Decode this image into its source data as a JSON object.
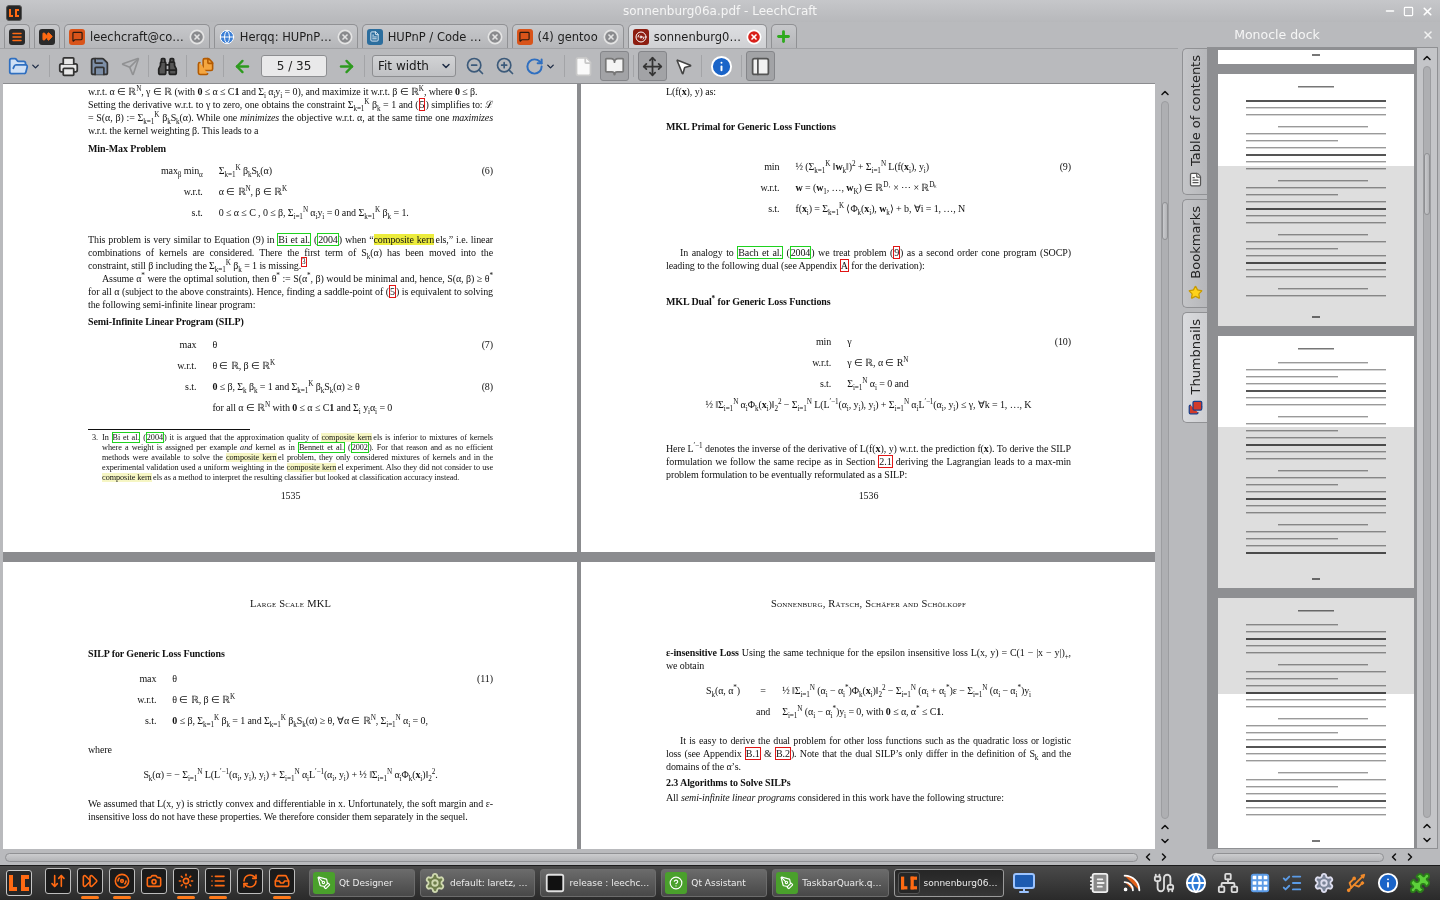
{
  "window": {
    "title": "sonnenburg06a.pdf - LeechCraft"
  },
  "tabs": [
    {
      "kind": "menu",
      "selected": false
    },
    {
      "kind": "media",
      "selected": false
    },
    {
      "kind": "chat",
      "label": "leechcraft@co…",
      "selected": false
    },
    {
      "kind": "web",
      "label": "Herqq: HUPnP…",
      "selected": false
    },
    {
      "kind": "project",
      "label": "HUPnP / Code …",
      "selected": false
    },
    {
      "kind": "chat",
      "label": "(4) gentoo",
      "selected": false
    },
    {
      "kind": "document",
      "label": "sonnenburg0…",
      "selected": true
    }
  ],
  "toolbar": {
    "items": [
      {
        "kind": "open",
        "disabled": false
      },
      {
        "kind": "separator"
      },
      {
        "kind": "print",
        "disabled": false
      },
      {
        "kind": "save",
        "disabled": false
      },
      {
        "kind": "export",
        "disabled": true
      },
      {
        "kind": "separator"
      },
      {
        "kind": "find",
        "disabled": false
      },
      {
        "kind": "separator"
      },
      {
        "kind": "copy",
        "disabled": false
      },
      {
        "kind": "separator"
      },
      {
        "kind": "prev_page",
        "disabled": false
      },
      {
        "kind": "page_field",
        "value": "5 / 35"
      },
      {
        "kind": "next_page",
        "disabled": false
      },
      {
        "kind": "separator"
      },
      {
        "kind": "zoom_mode",
        "value": "Fit width"
      },
      {
        "kind": "zoom_out",
        "disabled": false
      },
      {
        "kind": "zoom_in",
        "disabled": false
      },
      {
        "kind": "rotate",
        "disabled": false
      },
      {
        "kind": "separator"
      },
      {
        "kind": "one_page",
        "selected": false,
        "disabled": false
      },
      {
        "kind": "two_pages",
        "selected": true,
        "disabled": false
      },
      {
        "kind": "separator"
      },
      {
        "kind": "pan",
        "selected": true,
        "disabled": false
      },
      {
        "kind": "select",
        "selected": false,
        "disabled": false
      },
      {
        "kind": "separator"
      },
      {
        "kind": "info",
        "disabled": false
      },
      {
        "kind": "separator"
      },
      {
        "kind": "sidebar",
        "selected": true,
        "disabled": false
      }
    ]
  },
  "document": {
    "pages": [
      {
        "blocks": [
          {
            "kind": "paragraph",
            "indent": false,
            "parts": [
              {
                "kind": "text",
                "text": "w.r.t. α ∈ ℝ$^{N}$, γ ∈ ℝ (with **0** ≤ α ≤ C**1** and Σ$_{i}$ α$_{i}$y$_{i}$ = 0), and maximize it w.r.t. β ∈ ℝ$^{K}$, where **0** ≤ β."
              }
            ]
          },
          {
            "kind": "paragraph",
            "indent": false,
            "parts": [
              {
                "kind": "text",
                "text": "Setting the derivative w.r.t. to γ to zero, one obtains the constraint Σ$_{k=1}$$^{K}$ β$_{k}$ = 1 and ("
              },
              {
                "kind": "ref",
                "text": "5"
              },
              {
                "kind": "text",
                "text": ") simplifies to: ℒ = S(α, β) := Σ$_{k=1}$$^{K}$ β$_{k}$S$_{k}$(α). While one *minimizes* the objective w.r.t. α, at the same time one *maximizes* w.r.t. the kernel weighting β. This leads to a"
              }
            ]
          },
          {
            "kind": "heading",
            "text": "Min-Max Problem"
          },
          {
            "kind": "equation",
            "rows": [
              {
                "kind": "row",
                "label": "max$_{β}$ min$_{α}$",
                "expr": "Σ$_{k=1}$$^{K}$ β$_{k}$S$_{k}$(α)",
                "number": "(6)"
              },
              {
                "kind": "row",
                "label": "w.r.t.",
                "expr": "α ∈ ℝ$^{N}$, β ∈ ℝ$^{K}$"
              },
              {
                "kind": "row",
                "label": "s.t.",
                "expr": "0 ≤ α ≤ C , 0 ≤ β, Σ$_{i=1}$$^{N}$ α$_{i}$y$_{i}$ = 0 and Σ$_{k=1}$$^{K}$ β$_{k}$ = 1."
              }
            ]
          },
          {
            "kind": "paragraph",
            "indent": false,
            "parts": [
              {
                "kind": "text",
                "text": "This problem is very similar to Equation (9) in "
              },
              {
                "kind": "cite",
                "text": "Bi et al."
              },
              {
                "kind": "text",
                "text": " ("
              },
              {
                "kind": "cite",
                "text": "2004"
              },
              {
                "kind": "text",
                "text": ") when “"
              },
              {
                "kind": "mark",
                "text": "composite kern",
                "color": "#ecec3c"
              },
              {
                "kind": "text",
                "text": "els,” i.e. linear combinations of kernels are considered.  There the first term of S$_{k}$(α) has been moved into the constraint, still β including the Σ$_{k=1}$$^{K}$ β$_{k}$ = 1 is missing."
              },
              {
                "kind": "footnote_ref",
                "text": "3"
              }
            ]
          },
          {
            "kind": "paragraph",
            "indent": true,
            "parts": [
              {
                "kind": "text",
                "text": "Assume α$^{*}$ were the optimal solution, then θ$^{*}$ := S(α$^{*}$, β) would be minimal and, hence, S(α, β) ≥ θ$^{*}$ for all α (subject to the above constraints).  Hence, finding a saddle-point of ("
              },
              {
                "kind": "ref",
                "text": "5"
              },
              {
                "kind": "text",
                "text": ") is equivalent to solving the following semi-infinite linear program:"
              }
            ]
          },
          {
            "kind": "heading",
            "text": "Semi-Infinite Linear Program (SILP)"
          },
          {
            "kind": "equation",
            "rows": [
              {
                "kind": "row",
                "label": "max",
                "expr": "θ",
                "number": "(7)"
              },
              {
                "kind": "row",
                "label": "w.r.t.",
                "expr": "θ ∈ ℝ, β ∈ ℝ$^{K}$"
              },
              {
                "kind": "row",
                "label": "s.t.",
                "expr": "**0** ≤ β, Σ$_{k}$ β$_{k}$ = 1 and Σ$_{k=1}$$^{K}$ β$_{k}$S$_{k}$(α) ≥ θ",
                "number": "(8)"
              },
              {
                "kind": "row",
                "expr": "for all α ∈ ℝ$^{N}$ with **0** ≤ α ≤ C**1** and Σ$_{i}$ y$_{i}$α$_{i}$ = 0"
              }
            ]
          },
          {
            "kind": "footnote",
            "number": "3.",
            "parts": [
              {
                "kind": "text",
                "text": "In "
              },
              {
                "kind": "cite",
                "text": "Bi et al."
              },
              {
                "kind": "text",
                "text": " ("
              },
              {
                "kind": "cite",
                "text": "2004"
              },
              {
                "kind": "text",
                "text": ") it is argued that the approximation quality of "
              },
              {
                "kind": "mark",
                "text": "composite kern",
                "color": "#f6f6c4"
              },
              {
                "kind": "text",
                "text": "els is inferior to mixtures of kernels where a weight is assigned per example *and* kernel as in "
              },
              {
                "kind": "cite",
                "text": "Bennett et al."
              },
              {
                "kind": "text",
                "text": " ("
              },
              {
                "kind": "cite",
                "text": "2002"
              },
              {
                "kind": "text",
                "text": "). For that reason and as no efficient methods were available to solve the "
              },
              {
                "kind": "mark",
                "text": "composite kern",
                "color": "#f6f6c4"
              },
              {
                "kind": "text",
                "text": "el problem, they only considered mixtures of kernels and in the experimental validation used a uniform weighting in the "
              },
              {
                "kind": "mark",
                "text": "composite kern",
                "color": "#f6f6c4"
              },
              {
                "kind": "text",
                "text": "el experiment. Also they did not consider to use "
              },
              {
                "kind": "mark",
                "text": "composite kern",
                "color": "#f6f6c4"
              },
              {
                "kind": "text",
                "text": "els as a method to interpret the resulting classifier but looked at classification accuracy instead."
              }
            ]
          },
          {
            "kind": "page_number",
            "text": "1535"
          }
        ]
      },
      {
        "blocks": [
          {
            "kind": "paragraph",
            "indent": false,
            "parts": [
              {
                "kind": "text",
                "text": "L(f(**x**), y) as:"
              }
            ]
          },
          {
            "kind": "heading",
            "text": "MKL Primal for Generic Loss Functions"
          },
          {
            "kind": "equation",
            "rows": [
              {
                "kind": "row",
                "label": "min",
                "expr": "½ (Σ$_{k=1}$$^{K}$ ‖**w**$_{k}$‖)$^{2}$ + Σ$_{i=1}$$^{N}$ L(f(**x**$_{i}$), y$_{i}$)",
                "number": "(9)"
              },
              {
                "kind": "row",
                "label": "w.r.t.",
                "expr": "**w** = (**w**$_{1}$, …, **w**$_{K}$) ∈ ℝ$^{D₁}$ × ⋯ × ℝ$^{Dₖ}$"
              },
              {
                "kind": "row",
                "label": "s.t.",
                "expr": "f(**x**$_{i}$) = Σ$_{k=1}$$^{K}$ ⟨Φ$_{k}$(**x**$_{i}$), **w**$_{k}$⟩ + b,  ∀i = 1, …, N"
              }
            ]
          },
          {
            "kind": "paragraph",
            "indent": true,
            "parts": [
              {
                "kind": "text",
                "text": "In analogy to "
              },
              {
                "kind": "cite",
                "text": "Bach et al."
              },
              {
                "kind": "text",
                "text": " ("
              },
              {
                "kind": "cite",
                "text": "2004"
              },
              {
                "kind": "text",
                "text": ") we treat problem ("
              },
              {
                "kind": "ref",
                "text": "9"
              },
              {
                "kind": "text",
                "text": ") as a second order cone program (SOCP) leading to the following dual (see Appendix "
              },
              {
                "kind": "ref",
                "text": "A"
              },
              {
                "kind": "text",
                "text": " for the derivation):"
              }
            ]
          },
          {
            "kind": "heading",
            "text": "MKL Dual$^{*}$ for Generic Loss Functions"
          },
          {
            "kind": "equation",
            "rows": [
              {
                "kind": "row",
                "label": "min",
                "expr": "γ",
                "number": "(10)"
              },
              {
                "kind": "row",
                "label": "w.r.t.",
                "expr": "γ ∈ ℝ, α ∈ R$^{N}$"
              },
              {
                "kind": "row",
                "label": "s.t.",
                "expr": "Σ$_{i=1}$$^{N}$ α$_{i}$ = 0   and"
              },
              {
                "kind": "wide",
                "expr": "½ ‖Σ$_{i=1}$$^{N}$ α$_{i}$Φ$_{k}$(**x**$_{i}$)‖$_{2}$$^{2}$ − Σ$_{i=1}$$^{N}$ L(L$^{′−1}$(α$_{i}$, y$_{i}$), y$_{i}$) + Σ$_{i=1}$$^{N}$ α$_{i}$L$^{′−1}$(α$_{i}$, y$_{i}$) ≤ γ, ∀k = 1, …, K"
              }
            ]
          },
          {
            "kind": "paragraph",
            "indent": false,
            "parts": [
              {
                "kind": "text",
                "text": "Here L$^{′−1}$ denotes the inverse of the derivative of L(f(**x**), y) w.r.t. the prediction f(**x**). To derive the SILP formulation we follow the same recipe as in Section "
              },
              {
                "kind": "ref",
                "text": "2.1"
              },
              {
                "kind": "text",
                "text": " deriving the Lagrangian leads to a max-min problem formulation to be eventually reformulated as a SILP:"
              }
            ]
          },
          {
            "kind": "page_number",
            "text": "1536"
          }
        ]
      },
      {
        "blocks": [
          {
            "kind": "running_head",
            "text": "Large Scale MKL"
          },
          {
            "kind": "heading",
            "text": "SILP for Generic Loss Functions"
          },
          {
            "kind": "equation",
            "rows": [
              {
                "kind": "row",
                "label": "max",
                "expr": "θ",
                "number": "(11)"
              },
              {
                "kind": "row",
                "label": "w.r.t.",
                "expr": "θ ∈ ℝ, β ∈ ℝ$^{K}$"
              },
              {
                "kind": "row",
                "label": "s.t.",
                "expr": "**0** ≤ β,  Σ$_{k=1}$$^{K}$ β$_{k}$ = 1  and  Σ$_{k=1}$$^{K}$ β$_{k}$S$_{k}$(α) ≥ θ, ∀α ∈ ℝ$^{N}$, Σ$_{i=1}$$^{N}$ α$_{i}$ = 0,"
              }
            ]
          },
          {
            "kind": "paragraph",
            "indent": false,
            "parts": [
              {
                "kind": "text",
                "text": "where"
              }
            ]
          },
          {
            "kind": "equation",
            "rows": [
              {
                "kind": "wide",
                "expr": "S$_{k}$(α) = − Σ$_{i=1}$$^{N}$ L(L$^{′−1}$(α$_{i}$, y$_{i}$), y$_{i}$) + Σ$_{i=1}$$^{N}$ α$_{i}$L$^{′−1}$(α$_{i}$, y$_{i}$) + ½ ‖Σ$_{i=1}$$^{N}$ α$_{i}$Φ$_{k}$(**x**$_{i}$)‖$_{2}$$^{2}$."
              }
            ]
          },
          {
            "kind": "paragraph",
            "indent": false,
            "parts": [
              {
                "kind": "text",
                "text": "We assumed that L(x, y) is strictly convex and differentiable in x. Unfortunately, the soft margin and ε-insensitive loss do not have these properties. We therefore consider them separately in the sequel."
              }
            ]
          }
        ]
      },
      {
        "blocks": [
          {
            "kind": "running_head",
            "text": "Sonnenburg, Rätsch, Schäfer and Schölkopf"
          },
          {
            "kind": "paragraph",
            "indent": false,
            "parts": [
              {
                "kind": "text",
                "text": "**ε-insensitive Loss**   Using the same technique for the epsilon insensitive loss L(x, y) = C(1 − |x − y|)$_{+}$, we obtain"
              }
            ]
          },
          {
            "kind": "equation",
            "rows": [
              {
                "kind": "row",
                "label": "S$_{k}$(α, α$^{*}$)",
                "relation": "=",
                "expr": "½ ‖Σ$_{i=1}$$^{N}$ (α$_{i}$ − α$_{i}$$^{*}$)Φ$_{k}$(**x**$_{i}$)‖$_{2}$$^{2}$ − Σ$_{i=1}$$^{N}$ (α$_{i}$ + α$_{i}$$^{*}$)ε − Σ$_{i=1}$$^{N}$ (α$_{i}$ − α$_{i}$$^{*}$)y$_{i}$"
              },
              {
                "kind": "row",
                "relation": "and",
                "expr": "Σ$_{i=1}$$^{N}$ (α$_{i}$ − α$_{i}$$^{*}$)y$_{i}$ = 0,  with **0** ≤ α, α$^{*}$ ≤ C**1**."
              }
            ]
          },
          {
            "kind": "paragraph",
            "indent": true,
            "parts": [
              {
                "kind": "text",
                "text": "It is easy to derive the dual problem for other loss functions such as the quadratic loss or logistic loss (see Appendix "
              },
              {
                "kind": "ref",
                "text": "B.1"
              },
              {
                "kind": "text",
                "text": " & "
              },
              {
                "kind": "ref",
                "text": "B.2"
              },
              {
                "kind": "text",
                "text": "). Note that the dual SILP’s only differ in the definition of S$_{k}$ and the domains of the α’s."
              }
            ]
          },
          {
            "kind": "heading",
            "text": "2.3  Algorithms to Solve SILPs"
          },
          {
            "kind": "paragraph",
            "indent": false,
            "parts": [
              {
                "kind": "text",
                "text": "All *semi-infinite linear programs* considered in this work have the following structure:"
              }
            ]
          }
        ]
      }
    ]
  },
  "dock": {
    "title": "Monocle dock",
    "tabs": [
      {
        "kind": "toc",
        "label": "Table of contents",
        "selected": false
      },
      {
        "kind": "bookmarks",
        "label": "Bookmarks",
        "selected": false
      },
      {
        "kind": "thumbnails",
        "label": "Thumbnails",
        "selected": true
      }
    ]
  },
  "taskbar": {
    "launchers": [
      {
        "kind": "transfers",
        "running": false
      },
      {
        "kind": "playback",
        "running": true
      },
      {
        "kind": "disc",
        "running": true
      },
      {
        "kind": "camera",
        "running": false
      },
      {
        "kind": "burst",
        "running": true
      },
      {
        "kind": "list",
        "running": true
      },
      {
        "kind": "refresh",
        "running": false
      },
      {
        "kind": "inbox",
        "running": true
      }
    ],
    "tasks": [
      {
        "kind": "designer",
        "label": "Qt Designer",
        "selected": false
      },
      {
        "kind": "gear",
        "label": "default:  laretz, …",
        "selected": false
      },
      {
        "kind": "terminal",
        "label": "release : leechc…",
        "selected": false
      },
      {
        "kind": "assistant",
        "label": "Qt Assistant",
        "selected": false
      },
      {
        "kind": "designer",
        "label": "TaskbarQuark.q…",
        "selected": false
      },
      {
        "kind": "document",
        "label": "sonnenburg06…",
        "selected": true
      }
    ],
    "tray": [
      {
        "kind": "notes"
      },
      {
        "kind": "rss"
      },
      {
        "kind": "plug"
      },
      {
        "kind": "globe"
      },
      {
        "kind": "network"
      },
      {
        "kind": "calendar"
      },
      {
        "kind": "tasks"
      },
      {
        "kind": "settings"
      },
      {
        "kind": "usb"
      },
      {
        "kind": "info"
      },
      {
        "kind": "puzzle"
      }
    ]
  }
}
